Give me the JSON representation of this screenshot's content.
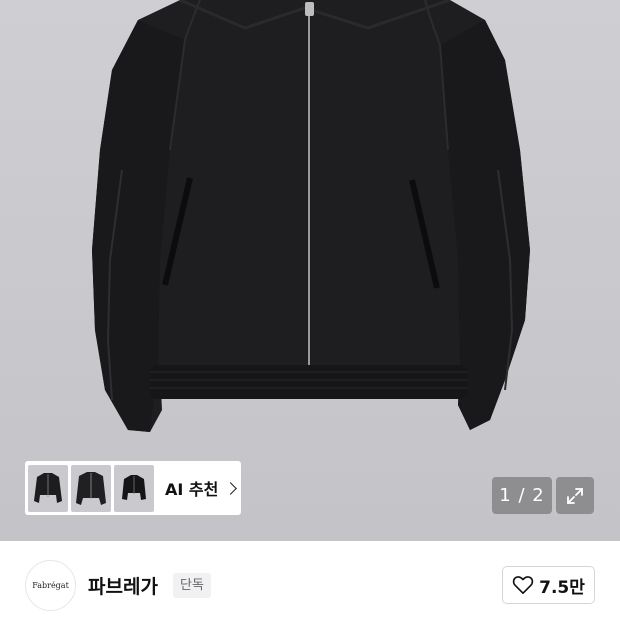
{
  "gallery": {
    "ai_recommend_label": "AI 추천",
    "page_counter": "1 / 2",
    "thumbnail_count": 3
  },
  "brand": {
    "logo_text": "Fabrégat",
    "name": "파브레가",
    "badge": "단독"
  },
  "like": {
    "count": "7.5만"
  },
  "icons": [
    "heart-icon",
    "expand-icon",
    "chevron-right-icon"
  ],
  "colors": {
    "background_gray": "#c9c9cd",
    "overlay": "#78787c",
    "badge_bg": "#f1f1f3"
  }
}
